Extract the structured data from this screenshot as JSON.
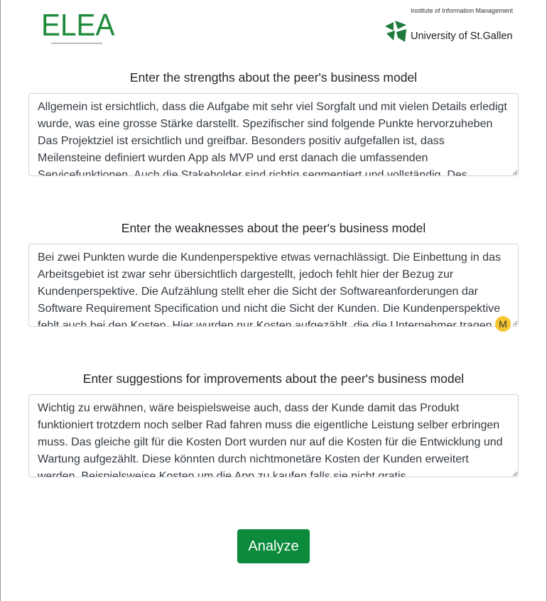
{
  "header": {
    "elea_logo_text": "ELEA",
    "institute_text": "Institute of Information Management",
    "university_text": "University of St.Gallen"
  },
  "sections": [
    {
      "title": "Enter the strengths about the peer's business model",
      "value": "Allgemein ist ersichtlich, dass die Aufgabe mit sehr viel Sorgfalt und mit vielen Details erledigt wurde, was eine grosse Stärke darstellt. Spezifischer sind folgende Punkte hervorzuheben Das Projektziel ist ersichtlich und greifbar. Besonders positiv aufgefallen ist, dass Meilensteine definiert wurden App als MVP und erst danach die umfassenden Servicefunktionen. Auch die Stakeholder sind richtig segmentiert und vollständig. Des"
    },
    {
      "title": "Enter the weaknesses about the peer's business model",
      "value": "Bei zwei Punkten wurde die Kundenperspektive etwas vernachlässigt. Die Einbettung in das Arbeitsgebiet ist zwar sehr übersichtlich dargestellt, jedoch fehlt hier der Bezug zur Kundenperspektive. Die Aufzählung stellt eher die Sicht der Softwareanforderungen dar Software Requirement Specification und nicht die Sicht der Kunden. Die Kundenperspektive fehlt auch bei den Kosten. Hier wurden nur Kosten aufgezählt, die die Unternehmer tragen"
    },
    {
      "title": "Enter suggestions for improvements about the peer's business model",
      "value": "Wichtig zu erwähnen, wäre beispielsweise auch, dass der Kunde damit das Produkt funktioniert trotzdem noch selber Rad fahren muss die eigentliche Leistung selber erbringen muss. Das gleiche gilt für die Kosten Dort wurden nur auf die Kosten für die Entwicklung und Wartung aufgezählt. Diese könnten durch nichtmonetäre Kosten der Kunden erweitert werden. Beispielsweise Kosten um die App zu kaufen falls sie nicht gratis"
    }
  ],
  "cursor_badge": "M",
  "analyze_button": "Analyze",
  "colors": {
    "brand_green": "#1f8a3b",
    "button_green": "#0a8a3a",
    "cursor_yellow": "#f7c62f"
  }
}
